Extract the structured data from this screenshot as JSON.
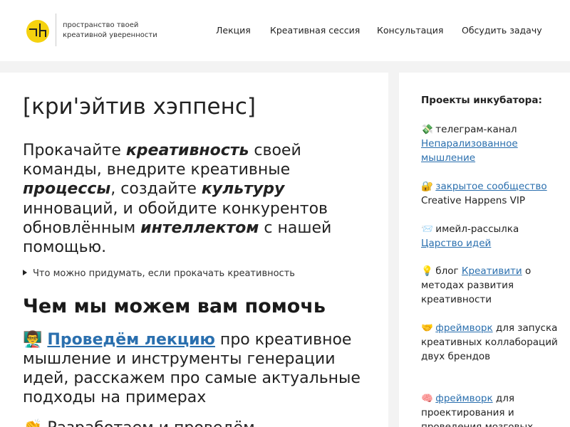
{
  "header": {
    "tagline_line1": "пространство твоей",
    "tagline_line2": "креативной уверенности",
    "nav": [
      "Лекция",
      "Креативная сессия",
      "Консультация",
      "Обсудить задачу"
    ]
  },
  "main": {
    "title": "[кри'эйтив хэппенс]",
    "intro": {
      "p1": "Прокачайте ",
      "b1": "креативность",
      "p2": " своей команды, внедрите креативные ",
      "b2": "процессы",
      "p3": ", создайте ",
      "b3": "культуру",
      "p4": " инноваций, и обойдите конкурентов обновлённым ",
      "b4": "интеллектом",
      "p5": " с нашей помощью."
    },
    "details_summary": "Что можно придумать, если прокачать креативность",
    "section_title": "Чем мы можем вам помочь",
    "offer1": {
      "emoji": "👨‍🏫",
      "link": "Проведём лекцию",
      "text": " про креативное мышление и инструменты генерации идей, расскажем про самые актуальные подходы на примерах"
    },
    "offer2": {
      "emoji": "👏",
      "text": "Разработаем и проведём"
    }
  },
  "sidebar": {
    "title": "Проекты инкубатора:",
    "items": [
      {
        "emoji": "💸",
        "before": "телеграм-канал ",
        "link": "Непарализованное мышление",
        "after": ""
      },
      {
        "emoji": "🔐",
        "before": "",
        "link": "закрытое сообщество",
        "after": " Creative Happens VIP"
      },
      {
        "emoji": "📨",
        "before": "имейл-рассылка ",
        "link": "Царство идей",
        "after": ""
      },
      {
        "emoji": "💡",
        "before": "блог ",
        "link": "Креативити",
        "after": " о методах развития креативности"
      },
      {
        "emoji": "🤝",
        "before": "",
        "link": "фреймворк",
        "after": " для запуска креативных коллабораций двух брендов"
      },
      {
        "emoji": "🧠",
        "before": "",
        "link": "фреймворк",
        "after": " для проектирования и проведения мозговых"
      }
    ]
  },
  "colors": {
    "link": "#2a6fae",
    "logo_yellow": "#f5d20f",
    "page_bg": "#f3f3f3"
  },
  "icons": {
    "logo": "logo-mark-icon",
    "details": "disclosure-triangle-icon"
  }
}
